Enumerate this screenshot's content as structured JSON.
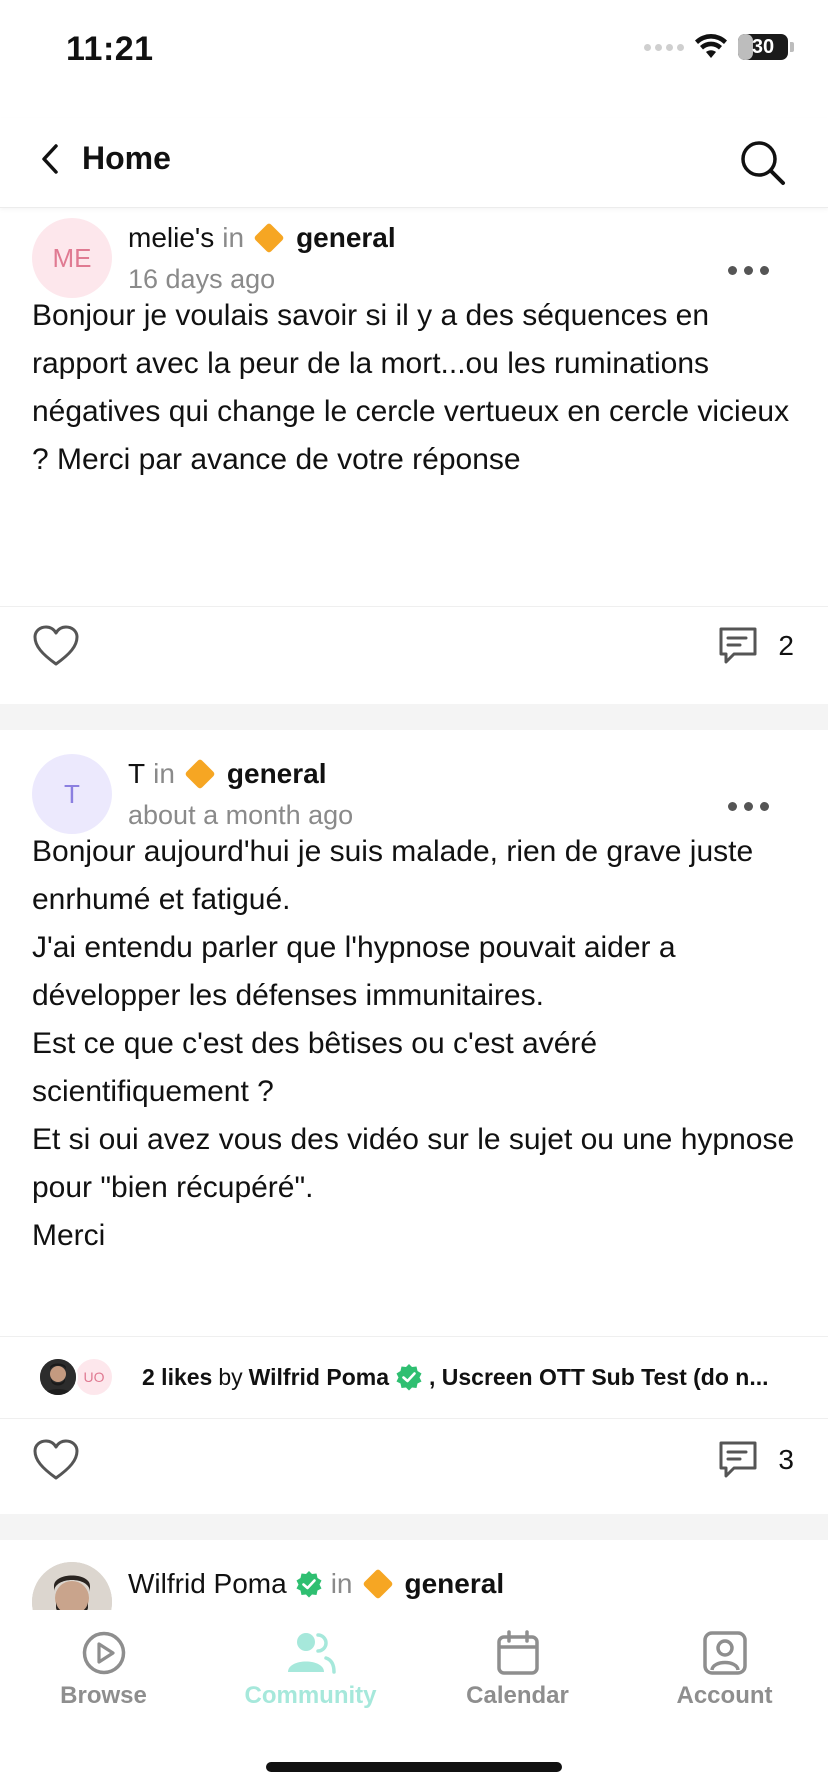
{
  "status_bar": {
    "time": "11:21",
    "battery": "30",
    "battery_level": 0.3
  },
  "header": {
    "back_label": "Home"
  },
  "posts": [
    {
      "avatar_initials": "ME",
      "author": "melie's",
      "in_label": "in",
      "channel": "general",
      "time_ago": "16 days ago",
      "body": "Bonjour je voulais savoir si il y a des séquences en rapport avec la peur de la mort...ou les ruminations négatives qui change le cercle vertueux en cercle vicieux ? Merci par avance de votre réponse",
      "comment_count": "2"
    },
    {
      "avatar_initials": "T",
      "author": "T",
      "in_label": "in",
      "channel": "general",
      "time_ago": "about a month ago",
      "body_lines": [
        "Bonjour aujourd'hui je suis malade, rien de grave juste enrhumé et fatigué.",
        "J'ai entendu parler que l'hypnose pouvait aider a développer les défenses immunitaires.",
        "Est ce que c'est des bêtises ou c'est avéré scientifiquement ?",
        "Et si oui avez vous des vidéo sur le sujet ou une hypnose pour \"bien récupéré\".",
        "Merci"
      ],
      "likes": {
        "count_label": "2 likes",
        "by_label": "by",
        "first_liker": "Wilfrid Poma",
        "rest": ", Uscreen OTT Sub Test (do n...",
        "second_avatar_initials": "UO"
      },
      "comment_count": "3"
    },
    {
      "author": "Wilfrid Poma",
      "in_label": "in",
      "channel": "general"
    }
  ],
  "tabs": [
    {
      "label": "Browse",
      "icon": "play-circle-icon",
      "active": false
    },
    {
      "label": "Community",
      "icon": "people-icon",
      "active": true
    },
    {
      "label": "Calendar",
      "icon": "calendar-icon",
      "active": false
    },
    {
      "label": "Account",
      "icon": "account-icon",
      "active": false
    }
  ],
  "colors": {
    "accent": "#a6e8db",
    "channel_diamond": "#f6a623",
    "verified": "#2fbf71",
    "avatar_me_bg": "#fde7ec",
    "avatar_me_fg": "#e07a92",
    "avatar_t_bg": "#ece9fd",
    "avatar_t_fg": "#8b7fe0"
  }
}
